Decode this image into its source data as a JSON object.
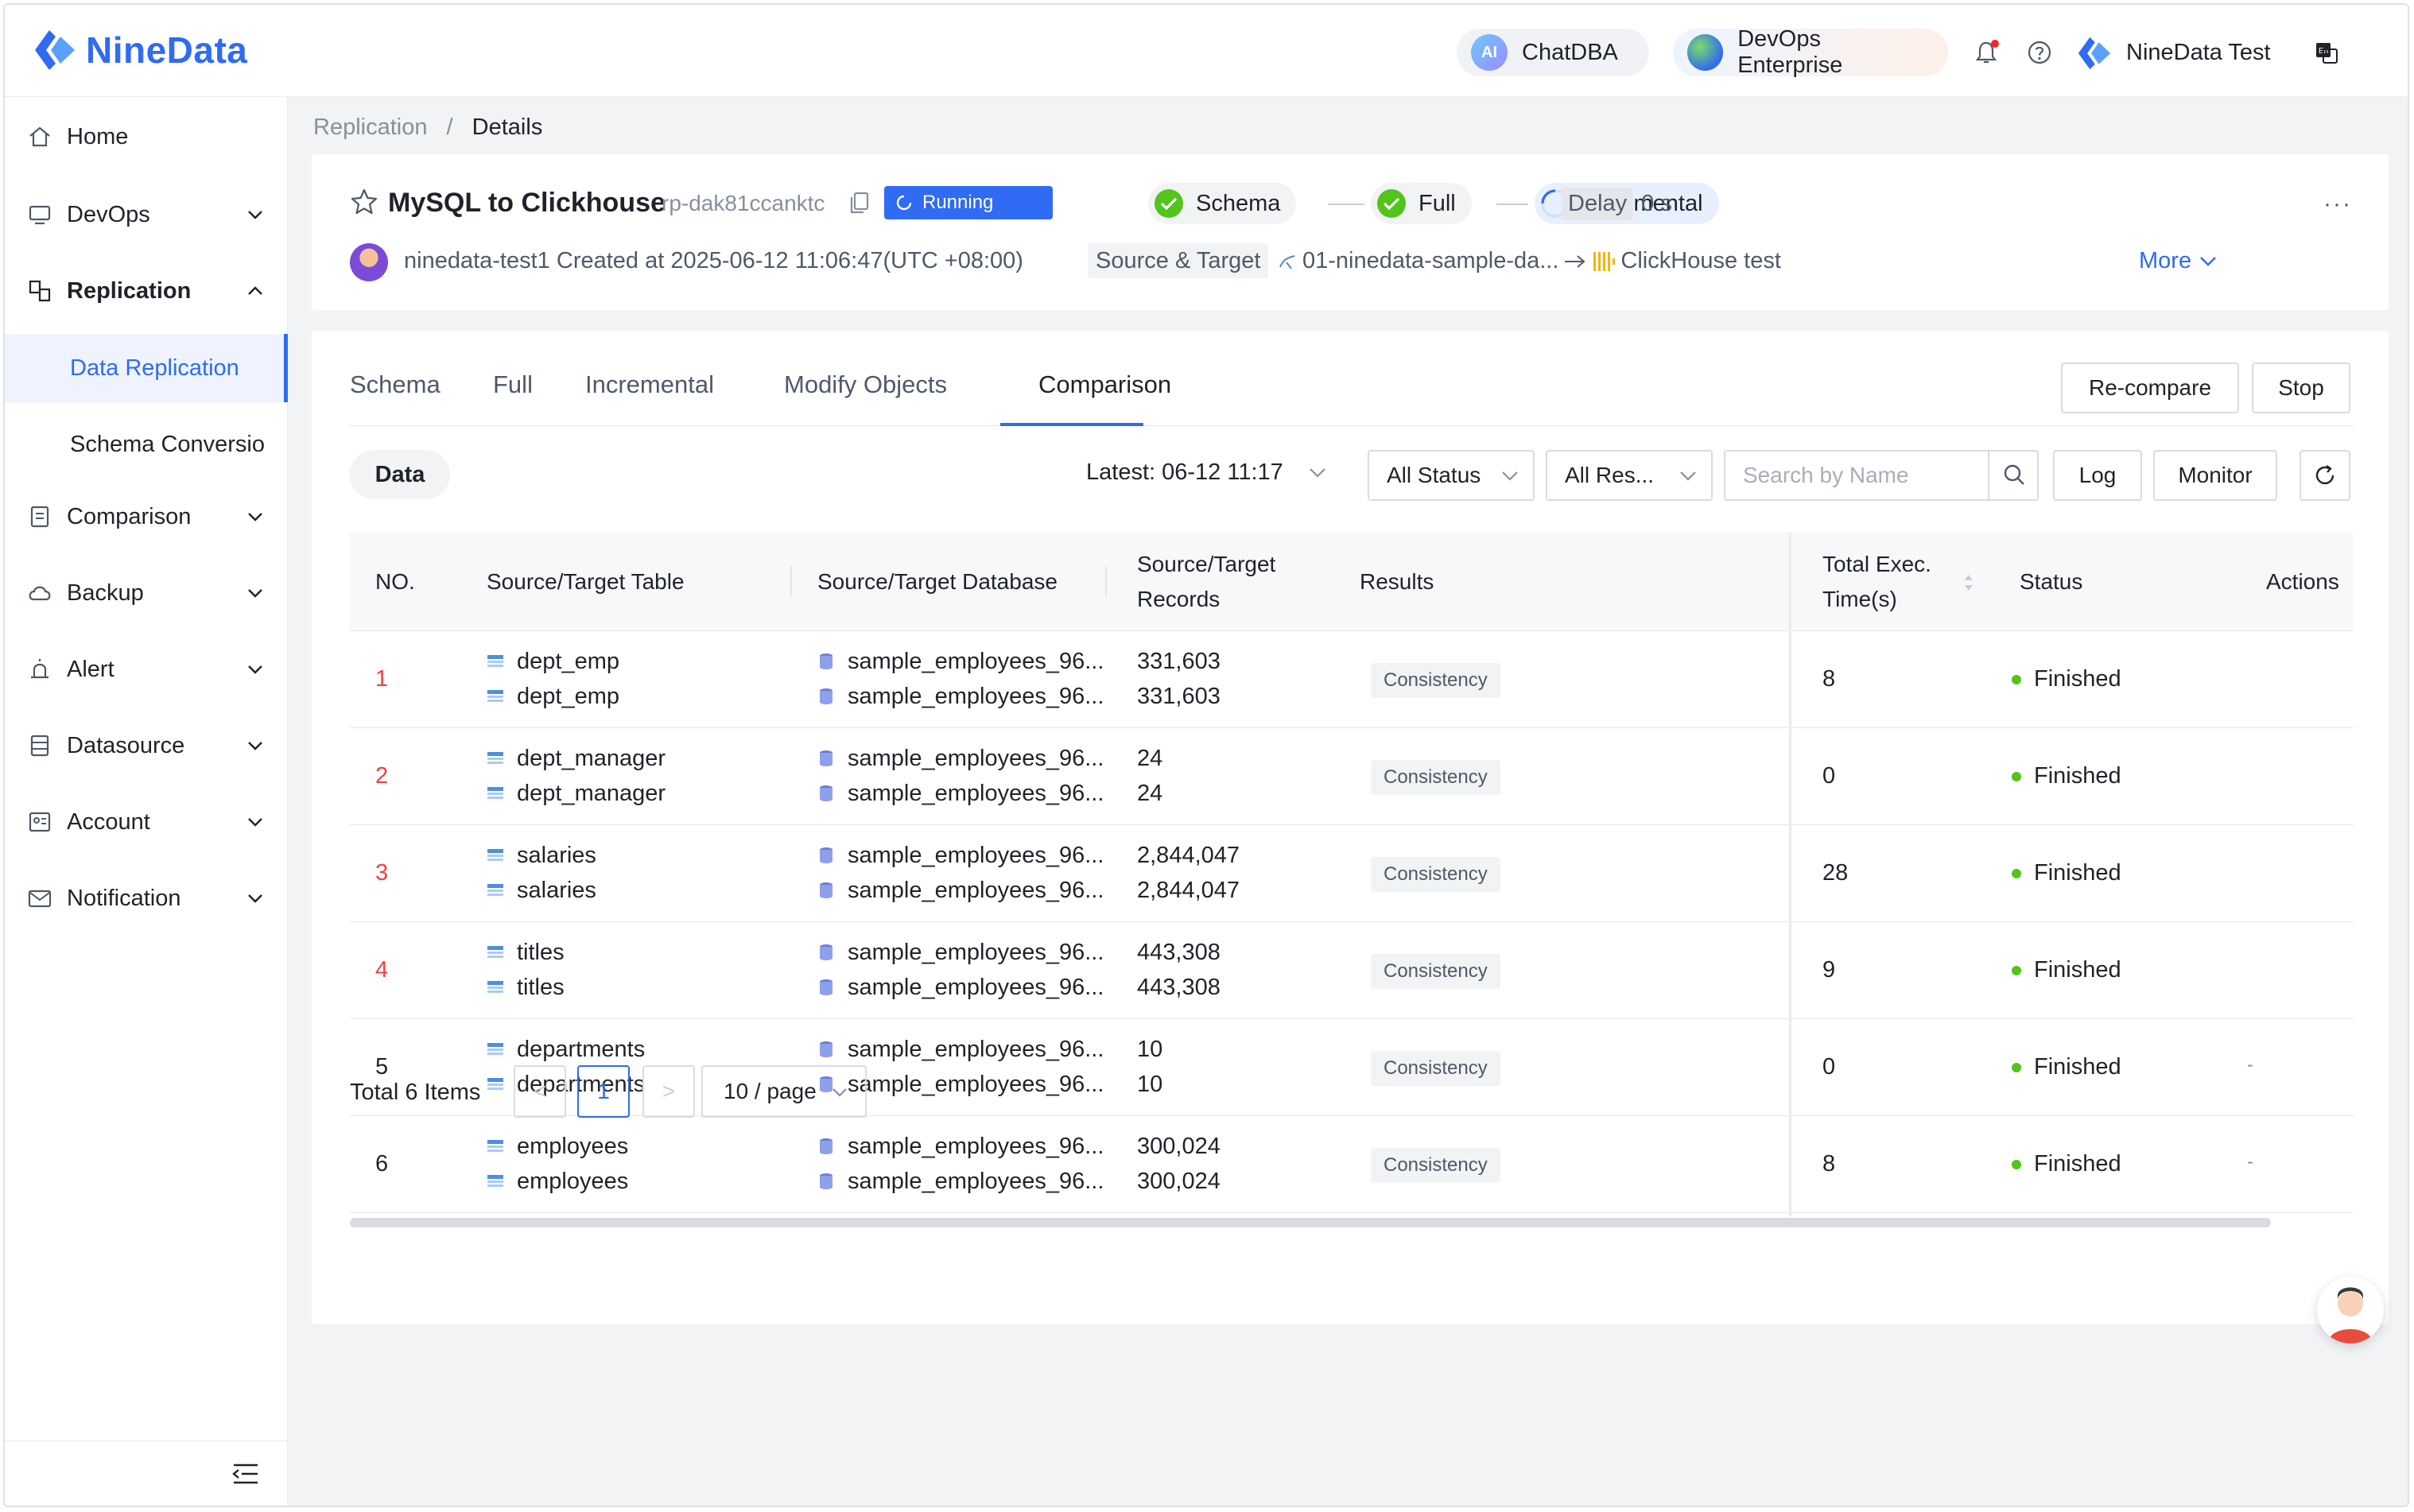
{
  "app": {
    "logo_text": "NineData",
    "brand_color": "#2f6bf3"
  },
  "topbar": {
    "chatdba_label": "ChatDBA",
    "chatdba_icon_text": "AI",
    "devops_label": "DevOps Enterprise",
    "user_name": "NineData Test",
    "icons": [
      "bell-icon",
      "help-icon",
      "language-icon"
    ]
  },
  "sidebar": {
    "items": [
      {
        "label": "Home",
        "icon": "home-icon"
      },
      {
        "label": "DevOps",
        "icon": "devops-icon"
      },
      {
        "label": "Replication",
        "icon": "replication-icon"
      },
      {
        "label": "Data Replication"
      },
      {
        "label": "Schema Conversio"
      },
      {
        "label": "Comparison",
        "icon": "comparison-icon"
      },
      {
        "label": "Backup",
        "icon": "backup-icon"
      },
      {
        "label": "Alert",
        "icon": "alert-icon"
      },
      {
        "label": "Datasource",
        "icon": "datasource-icon"
      },
      {
        "label": "Account",
        "icon": "account-icon"
      },
      {
        "label": "Notification",
        "icon": "notification-icon"
      }
    ]
  },
  "breadcrumb": {
    "parent": "Replication",
    "separator": "/",
    "current": "Details"
  },
  "task": {
    "name": "MySQL to Clickhouse",
    "id": "rp-dak81ccanktc",
    "state": "Running",
    "stages": [
      "Schema",
      "Full",
      "Incremental"
    ],
    "delay_label": "Delay",
    "delay_value": "0 s",
    "more_dots": "···",
    "creator": "ninedata-test1",
    "created_at": "Created at 2025-06-12 11:06:47(UTC +08:00)",
    "source_target_label": "Source & Target",
    "source": "01-ninedata-sample-da...",
    "target": "ClickHouse test",
    "more_label": "More"
  },
  "tabs": [
    "Schema",
    "Full",
    "Incremental",
    "Modify Objects",
    "Comparison"
  ],
  "active_tab": "Comparison",
  "actions": {
    "recompare": "Re-compare",
    "stop": "Stop"
  },
  "filters": {
    "type_label": "Data",
    "latest": "Latest: 06-12 11:17",
    "status_select": "All Status",
    "result_select": "All Res...",
    "search_placeholder": "Search by Name",
    "log": "Log",
    "monitor": "Monitor"
  },
  "table": {
    "headers": {
      "no": "NO.",
      "table": "Source/Target Table",
      "database": "Source/Target Database",
      "records_1": "Source/Target",
      "records_2": "Records",
      "results": "Results",
      "exec_1": "Total Exec.",
      "exec_2": "Time(s)",
      "status": "Status",
      "actions": "Actions"
    },
    "rows": [
      {
        "no": "1",
        "src_table": "dept_emp",
        "tgt_table": "dept_emp",
        "src_db": "sample_employees_96...",
        "tgt_db": "sample_employees_96...",
        "src_records": "331,603",
        "tgt_records": "331,603",
        "result": "Consistency",
        "exec": "8",
        "status": "Finished",
        "action": ""
      },
      {
        "no": "2",
        "src_table": "dept_manager",
        "tgt_table": "dept_manager",
        "src_db": "sample_employees_96...",
        "tgt_db": "sample_employees_96...",
        "src_records": "24",
        "tgt_records": "24",
        "result": "Consistency",
        "exec": "0",
        "status": "Finished",
        "action": ""
      },
      {
        "no": "3",
        "src_table": "salaries",
        "tgt_table": "salaries",
        "src_db": "sample_employees_96...",
        "tgt_db": "sample_employees_96...",
        "src_records": "2,844,047",
        "tgt_records": "2,844,047",
        "result": "Consistency",
        "exec": "28",
        "status": "Finished",
        "action": ""
      },
      {
        "no": "4",
        "src_table": "titles",
        "tgt_table": "titles",
        "src_db": "sample_employees_96...",
        "tgt_db": "sample_employees_96...",
        "src_records": "443,308",
        "tgt_records": "443,308",
        "result": "Consistency",
        "exec": "9",
        "status": "Finished",
        "action": ""
      },
      {
        "no": "5",
        "src_table": "departments",
        "tgt_table": "departments",
        "src_db": "sample_employees_96...",
        "tgt_db": "sample_employees_96...",
        "src_records": "10",
        "tgt_records": "10",
        "result": "Consistency",
        "exec": "0",
        "status": "Finished",
        "action": "-"
      },
      {
        "no": "6",
        "src_table": "employees",
        "tgt_table": "employees",
        "src_db": "sample_employees_96...",
        "tgt_db": "sample_employees_96...",
        "src_records": "300,024",
        "tgt_records": "300,024",
        "result": "Consistency",
        "exec": "8",
        "status": "Finished",
        "action": "-"
      }
    ]
  },
  "pagination": {
    "total": "Total 6 Items",
    "prev": "<",
    "current": "1",
    "next": ">",
    "page_size": "10 / page"
  },
  "colors": {
    "accent": "#2f6bf3",
    "success": "#52c41a",
    "error": "#f53f3f"
  }
}
